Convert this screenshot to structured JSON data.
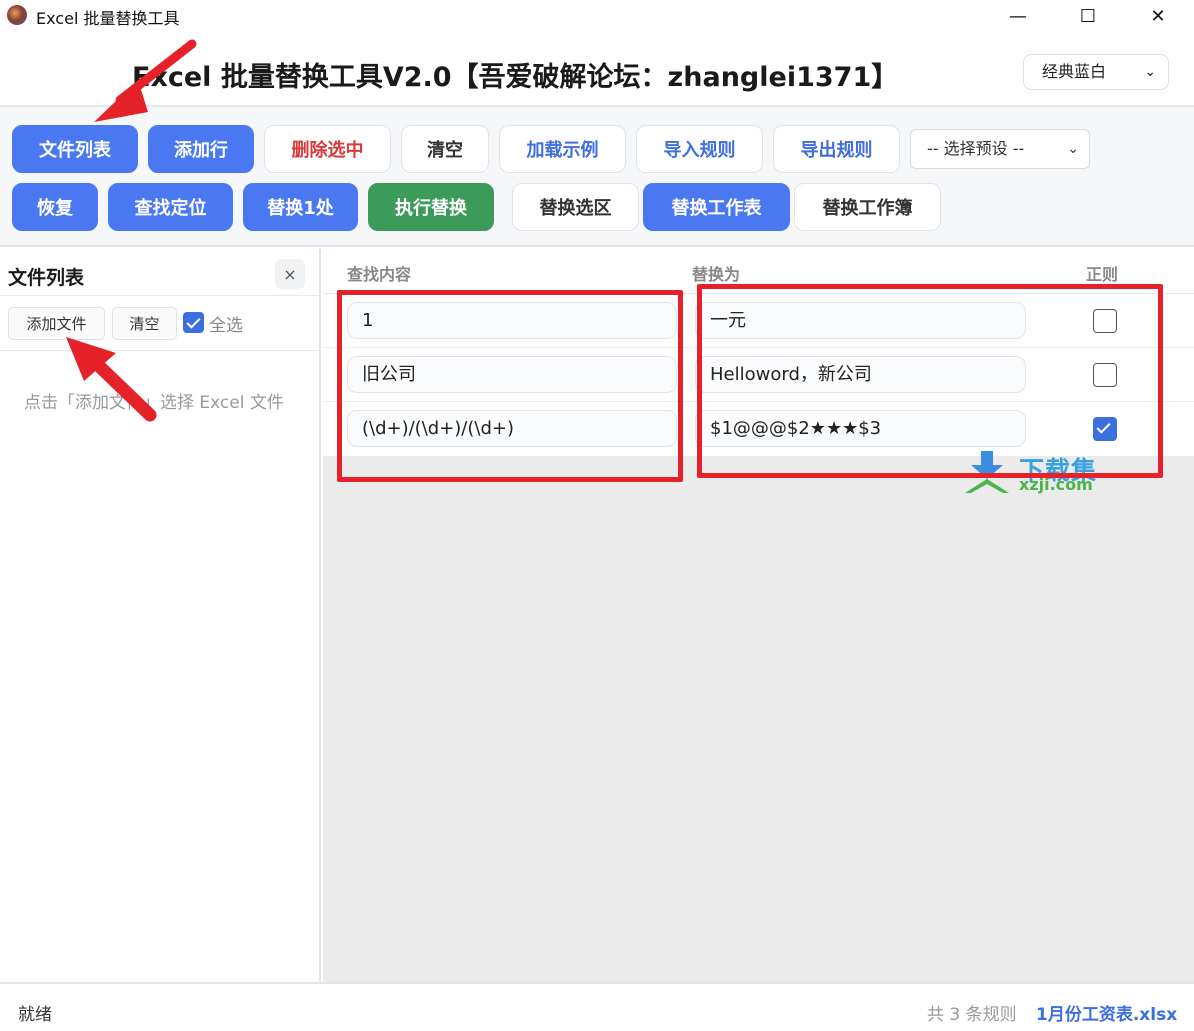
{
  "window": {
    "title": "Excel 批量替换工具",
    "minimize": "—",
    "maximize": "☐",
    "close": "✕"
  },
  "header": {
    "title": "Excel 批量替换工具V2.0【吾爱破解论坛：zhanglei1371】",
    "theme": "经典蓝白"
  },
  "toolbar": {
    "file_list": "文件列表",
    "add_row": "添加行",
    "delete_selected": "删除选中",
    "clear": "清空",
    "load_example": "加载示例",
    "import_rules": "导入规则",
    "export_rules": "导出规则",
    "preset_placeholder": "-- 选择预设 --",
    "restore": "恢复",
    "find_locate": "查找定位",
    "replace_one": "替换1处",
    "execute_replace": "执行替换",
    "replace_selection": "替换选区",
    "replace_sheet": "替换工作表",
    "replace_workbook": "替换工作簿"
  },
  "sidebar": {
    "title": "文件列表",
    "close": "×",
    "add_file": "添加文件",
    "clear": "清空",
    "select_all": "全选",
    "select_all_checked": true,
    "empty_hint": "点击「添加文件」选择 Excel 文件"
  },
  "table": {
    "headers": {
      "find": "查找内容",
      "replace": "替换为",
      "regex": "正则"
    },
    "rows": [
      {
        "find": "1",
        "replace": "一元",
        "regex": false
      },
      {
        "find": "旧公司",
        "replace": "Helloword，新公司",
        "regex": false
      },
      {
        "find": "(\\d+)/(\\d+)/(\\d+)",
        "replace": "$1@@@$2★★★$3",
        "regex": true
      }
    ]
  },
  "watermark": {
    "brand": "下载集",
    "site": "xzji.com"
  },
  "status": {
    "state": "就绪",
    "rule_count": "共 3 条规则",
    "file": "1月份工资表.xlsx"
  },
  "colors": {
    "primary": "#4a78f0",
    "success": "#3c9a5a",
    "danger": "#d73a3a",
    "annotation": "#e5222a"
  }
}
